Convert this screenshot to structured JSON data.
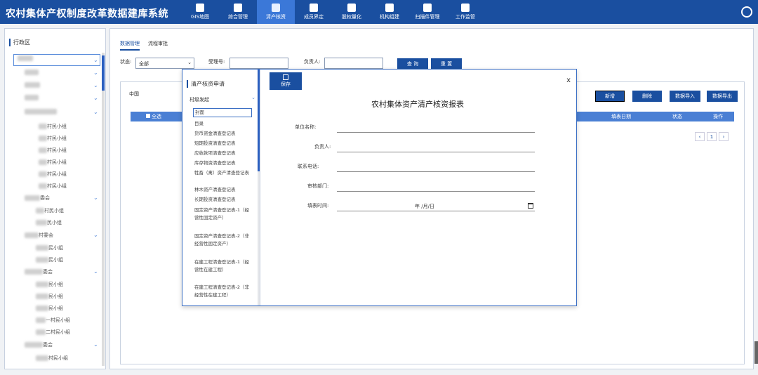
{
  "app": {
    "title": "农村集体产权制度改革数据建库系统"
  },
  "nav": [
    {
      "label": "GIS地图"
    },
    {
      "label": "综合管理"
    },
    {
      "label": "清产核资"
    },
    {
      "label": "成员界定"
    },
    {
      "label": "股权量化"
    },
    {
      "label": "机构组建"
    },
    {
      "label": "扫描件管理"
    },
    {
      "label": "工作监管"
    }
  ],
  "left_panel": {
    "title": "行政区",
    "tree": [
      {
        "label": "村民小组"
      },
      {
        "label": "村民小组"
      },
      {
        "label": "村民小组"
      },
      {
        "label": "村民小组"
      },
      {
        "label": "村民小组"
      },
      {
        "label": "村民小组"
      },
      {
        "label": "委会"
      },
      {
        "label": "村民小组"
      },
      {
        "label": "民小组"
      },
      {
        "label": "村委会"
      },
      {
        "label": "民小组"
      },
      {
        "label": "民小组"
      },
      {
        "label": "委会"
      },
      {
        "label": "民小组"
      },
      {
        "label": "民小组"
      },
      {
        "label": "民小组"
      },
      {
        "label": "一村民小组"
      },
      {
        "label": "二村民小组"
      },
      {
        "label": "委会"
      },
      {
        "label": "村民小组"
      }
    ]
  },
  "main": {
    "tabs": [
      {
        "label": "数据管理"
      },
      {
        "label": "流程审批"
      }
    ],
    "filters": {
      "status_label": "状态:",
      "status_value": "全部",
      "accept_label": "受理号:",
      "owner_label": "负责人:",
      "query": "查 询",
      "reset": "重 置"
    },
    "region": "中国",
    "actions": {
      "add": "新增",
      "delete": "删除",
      "import": "数据导入",
      "export": "数据导出"
    },
    "table": {
      "select_all": "全选",
      "columns": [
        "填表日期",
        "状态",
        "操作"
      ]
    },
    "pager": {
      "prev": "‹",
      "page": "1",
      "next": "›"
    }
  },
  "modal": {
    "left_title": "清产核资申请",
    "dropdown": "村级发起",
    "items": [
      "封面",
      "目录",
      "货币资金清查登记表",
      "短期投资清查登记表",
      "应收款项清查登记表",
      "库存物资清查登记表",
      "牲畜（禽）资产清查登记表",
      "林木资产清查登记表",
      "长期投资清查登记表",
      "固定资产清查登记表-1（经营性固定资产）",
      "固定资产清查登记表-2（非经营性固定资产）",
      "在建工程清查登记表-1（经营性在建工程）",
      "在建工程清查登记表-2（非经营性在建工程）"
    ],
    "save": "保存",
    "close": "x",
    "form_title": "农村集体资产清产核资报表",
    "fields": [
      {
        "label": "单位名称:"
      },
      {
        "label": "负责人:"
      },
      {
        "label": "联系电话:"
      },
      {
        "label": "审核部门:"
      },
      {
        "label": "填表时间:",
        "placeholder": "年 /月/日"
      }
    ]
  }
}
